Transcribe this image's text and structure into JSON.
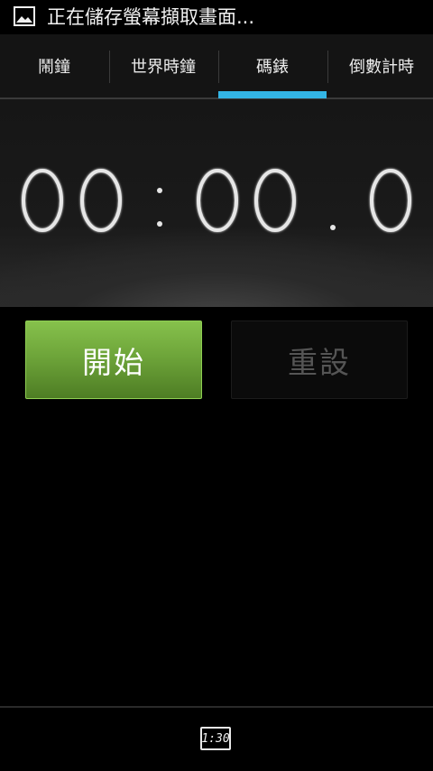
{
  "status_bar": {
    "icon": "image-icon",
    "text": "正在儲存螢幕擷取畫面..."
  },
  "tabs": [
    {
      "label": "鬧鐘",
      "selected": false
    },
    {
      "label": "世界時鐘",
      "selected": false
    },
    {
      "label": "碼錶",
      "selected": true
    },
    {
      "label": "倒數計時",
      "selected": false
    }
  ],
  "accent_color": "#33b5e5",
  "timer": {
    "display": "00:00.0",
    "digits": [
      "0",
      "0",
      "0",
      "0",
      "0"
    ]
  },
  "buttons": {
    "start_label": "開始",
    "start_color": "#6ea53a",
    "reset_label": "重設",
    "reset_enabled": false
  },
  "bottom_bar": {
    "menu_icon": "clock-icon",
    "menu_text": "1:30"
  }
}
